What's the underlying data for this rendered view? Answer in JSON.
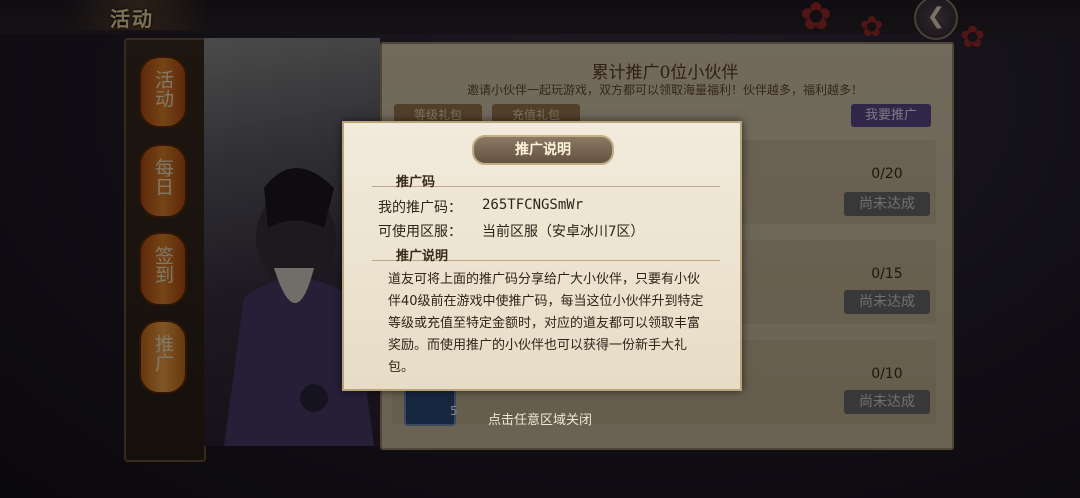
{
  "header": {
    "title": "活动",
    "back_icon": "back-arrow-icon"
  },
  "sidebar": {
    "tabs": [
      {
        "label": "活动"
      },
      {
        "label": "每日"
      },
      {
        "label": "签到"
      },
      {
        "label": "推广",
        "active": true
      }
    ]
  },
  "panel": {
    "title": "累计推广0位小伙伴",
    "subtitle": "邀请小伙伴一起玩游戏，双方都可以领取海量福利！伙伴越多，福利越多！",
    "tabs": [
      {
        "label": "等级礼包"
      },
      {
        "label": "充值礼包"
      }
    ],
    "promote_button": "我要推广",
    "rows": [
      {
        "count": "0/20",
        "button": "尚未达成"
      },
      {
        "count": "0/15",
        "button": "尚未达成"
      },
      {
        "count": "0/10",
        "button": "尚未达成"
      }
    ],
    "item_quantity": "5"
  },
  "modal": {
    "title": "推广说明",
    "code_section_title": "推广码",
    "code_label": "我的推广码：",
    "code_value": "265TFCNGSmWr",
    "server_label": "可使用区服：",
    "server_value": "当前区服（安卓冰川7区）",
    "desc_section_title": "推广说明",
    "description": "道友可将上面的推广码分享给广大小伙伴，只要有小伙伴40级前在游戏中使推广码，每当这位小伙伴升到特定等级或充值至特定金额时，对应的道友都可以领取丰富奖励。而使用推广的小伙伴也可以获得一份新手大礼包。",
    "close_hint": "点击任意区域关闭"
  },
  "colors": {
    "accent": "#f2d9a4",
    "panel": "#d9cdb2",
    "overlay": "rgba(0,0,0,0.48)"
  }
}
